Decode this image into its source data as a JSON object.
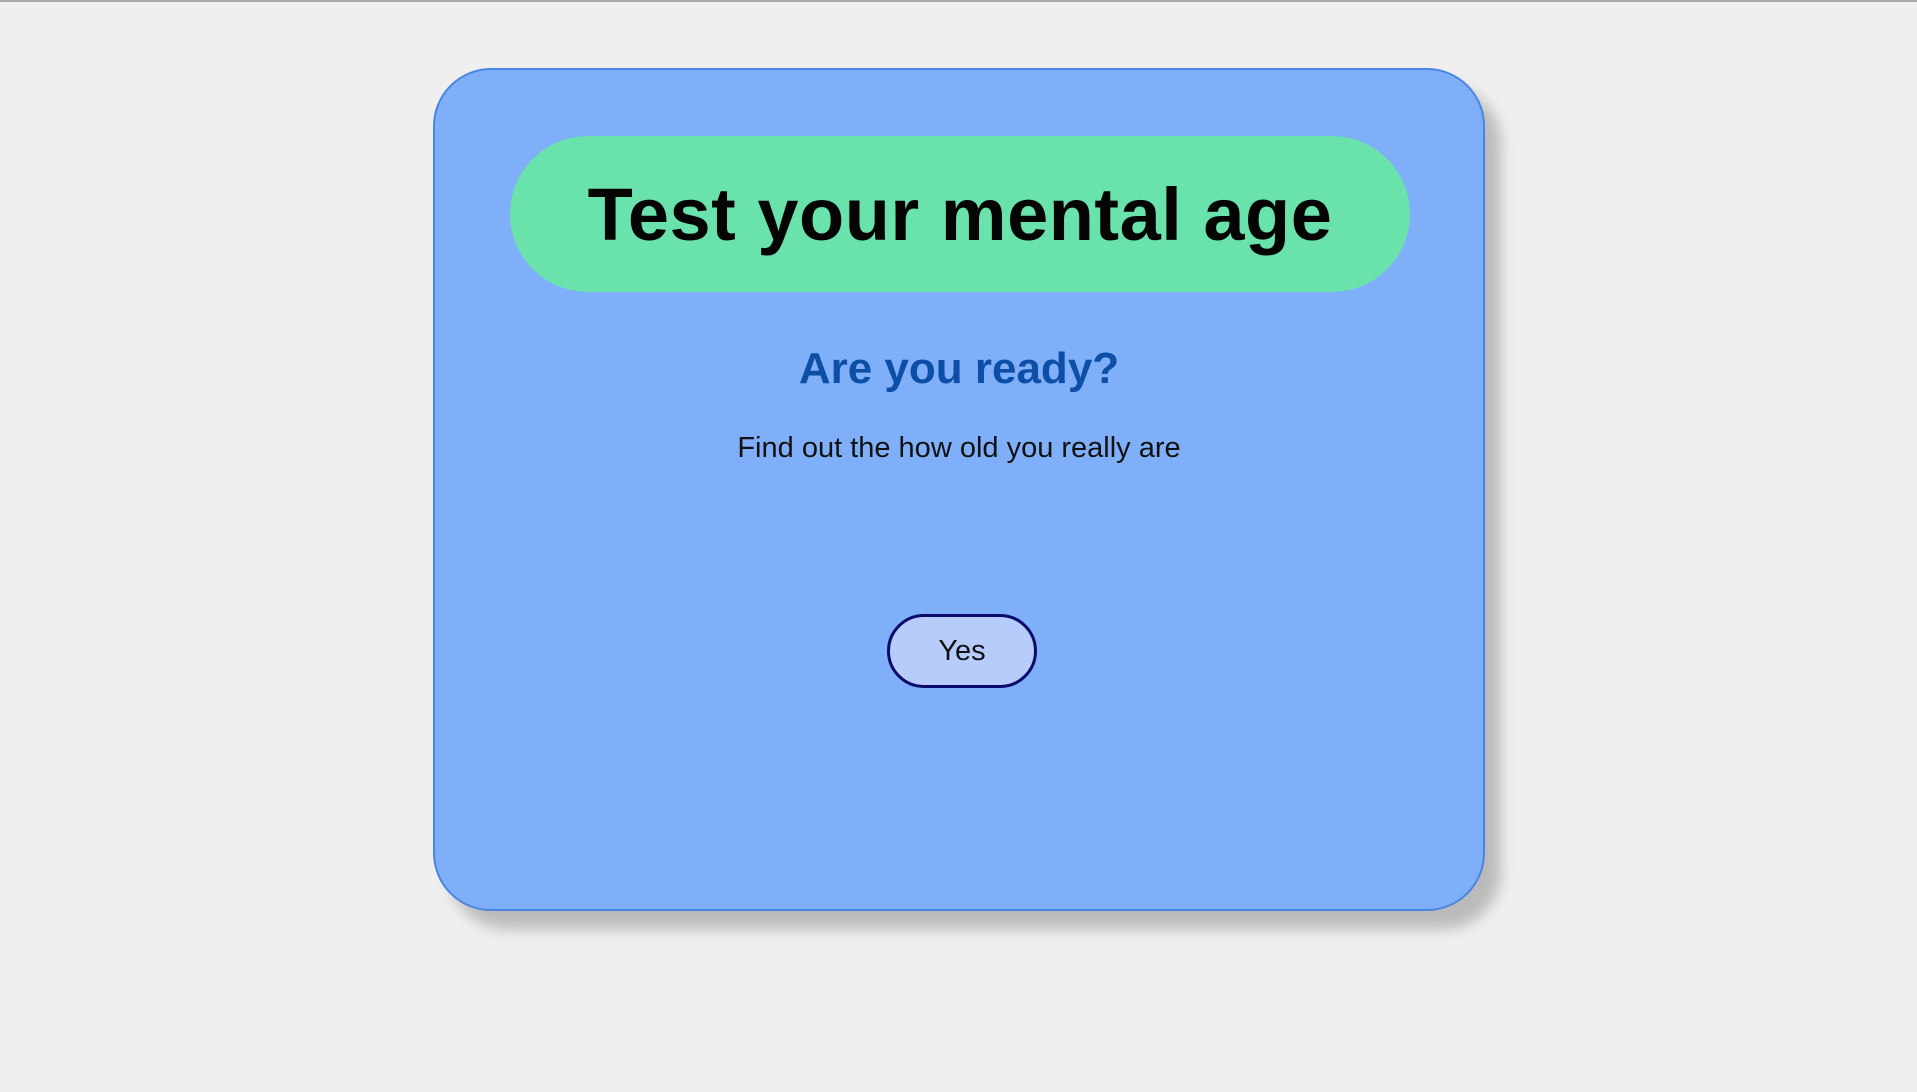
{
  "card": {
    "title": "Test your mental age",
    "subtitle": "Are you ready?",
    "description": "Find out the how old you really are",
    "yes_label": "Yes"
  },
  "colors": {
    "page_background": "#efefef",
    "card_background": "#80aff9",
    "card_border": "#4a86e0",
    "title_pill": "#6ae2ab",
    "subtitle_text": "#0d4ea6",
    "button_background": "#b7ccfb",
    "button_border": "#0b0b6b"
  }
}
